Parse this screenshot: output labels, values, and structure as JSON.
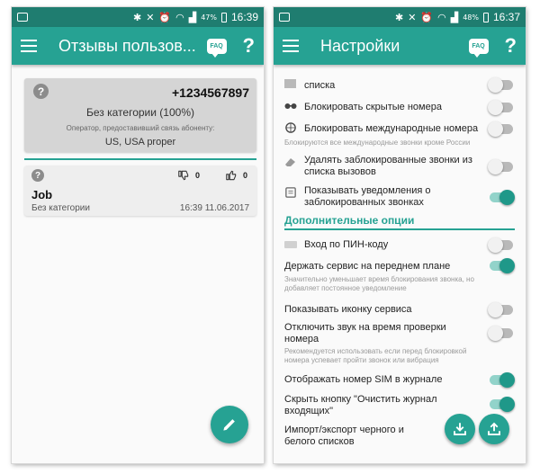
{
  "left": {
    "status": {
      "battery": "47%",
      "time": "16:39"
    },
    "app_bar": {
      "title": "Отзывы пользов...",
      "faq_label": "FAQ",
      "help_label": "?"
    },
    "number_card": {
      "phone_number": "+1234567897",
      "category": "Без категории (100%)",
      "operator_label": "Оператор, предоставивший связь абоненту:",
      "operator_value": "US, USA proper"
    },
    "review": {
      "dislikes": "0",
      "likes": "0",
      "title": "Job",
      "category": "Без категории",
      "datetime": "16:39 11.06.2017"
    }
  },
  "right": {
    "status": {
      "battery": "48%",
      "time": "16:37"
    },
    "app_bar": {
      "title": "Настройки",
      "faq_label": "FAQ",
      "help_label": "?"
    },
    "settings": {
      "lists_tail": "списка",
      "block_hidden": "Блокировать скрытые номера",
      "block_international": "Блокировать международные номера",
      "block_international_desc": "Блокируются все международные звонки кроме России",
      "delete_blocked_line1": "Удалять заблокированные звонки из",
      "delete_blocked_line2": "списка вызовов",
      "show_notifications_line1": "Показывать уведомления о",
      "show_notifications_line2": "заблокированных звонках",
      "section_extra": "Дополнительные опции",
      "pin_login": "Вход по ПИН-коду",
      "foreground_service": "Держать сервис на переднем плане",
      "foreground_desc_line1": "Значительно уменьшает время блокирования звонка, но",
      "foreground_desc_line2": "добавляет постоянное уведомление",
      "show_service_icon": "Показывать иконку сервиса",
      "mute_line1": "Отключить звук на время проверки",
      "mute_line2": "номера",
      "mute_desc_line1": "Рекомендуется использовать если перед блокировкой",
      "mute_desc_line2": "номера успевает пройти звонок или вибрация",
      "sim_in_log": "Отображать номер SIM в журнале",
      "hide_clear_line1": "Скрыть кнопку \"Очистить журнал",
      "hide_clear_line2": "входящих\"",
      "import_export_line1": "Импорт/экспорт черного и",
      "import_export_line2": "белого списков"
    }
  },
  "colors": {
    "status_bar": "#1f7d70",
    "app_bar": "#26a293",
    "accent": "#26a293",
    "toggle_on": "#1f9889",
    "toggle_off": "#b9b9b9"
  }
}
